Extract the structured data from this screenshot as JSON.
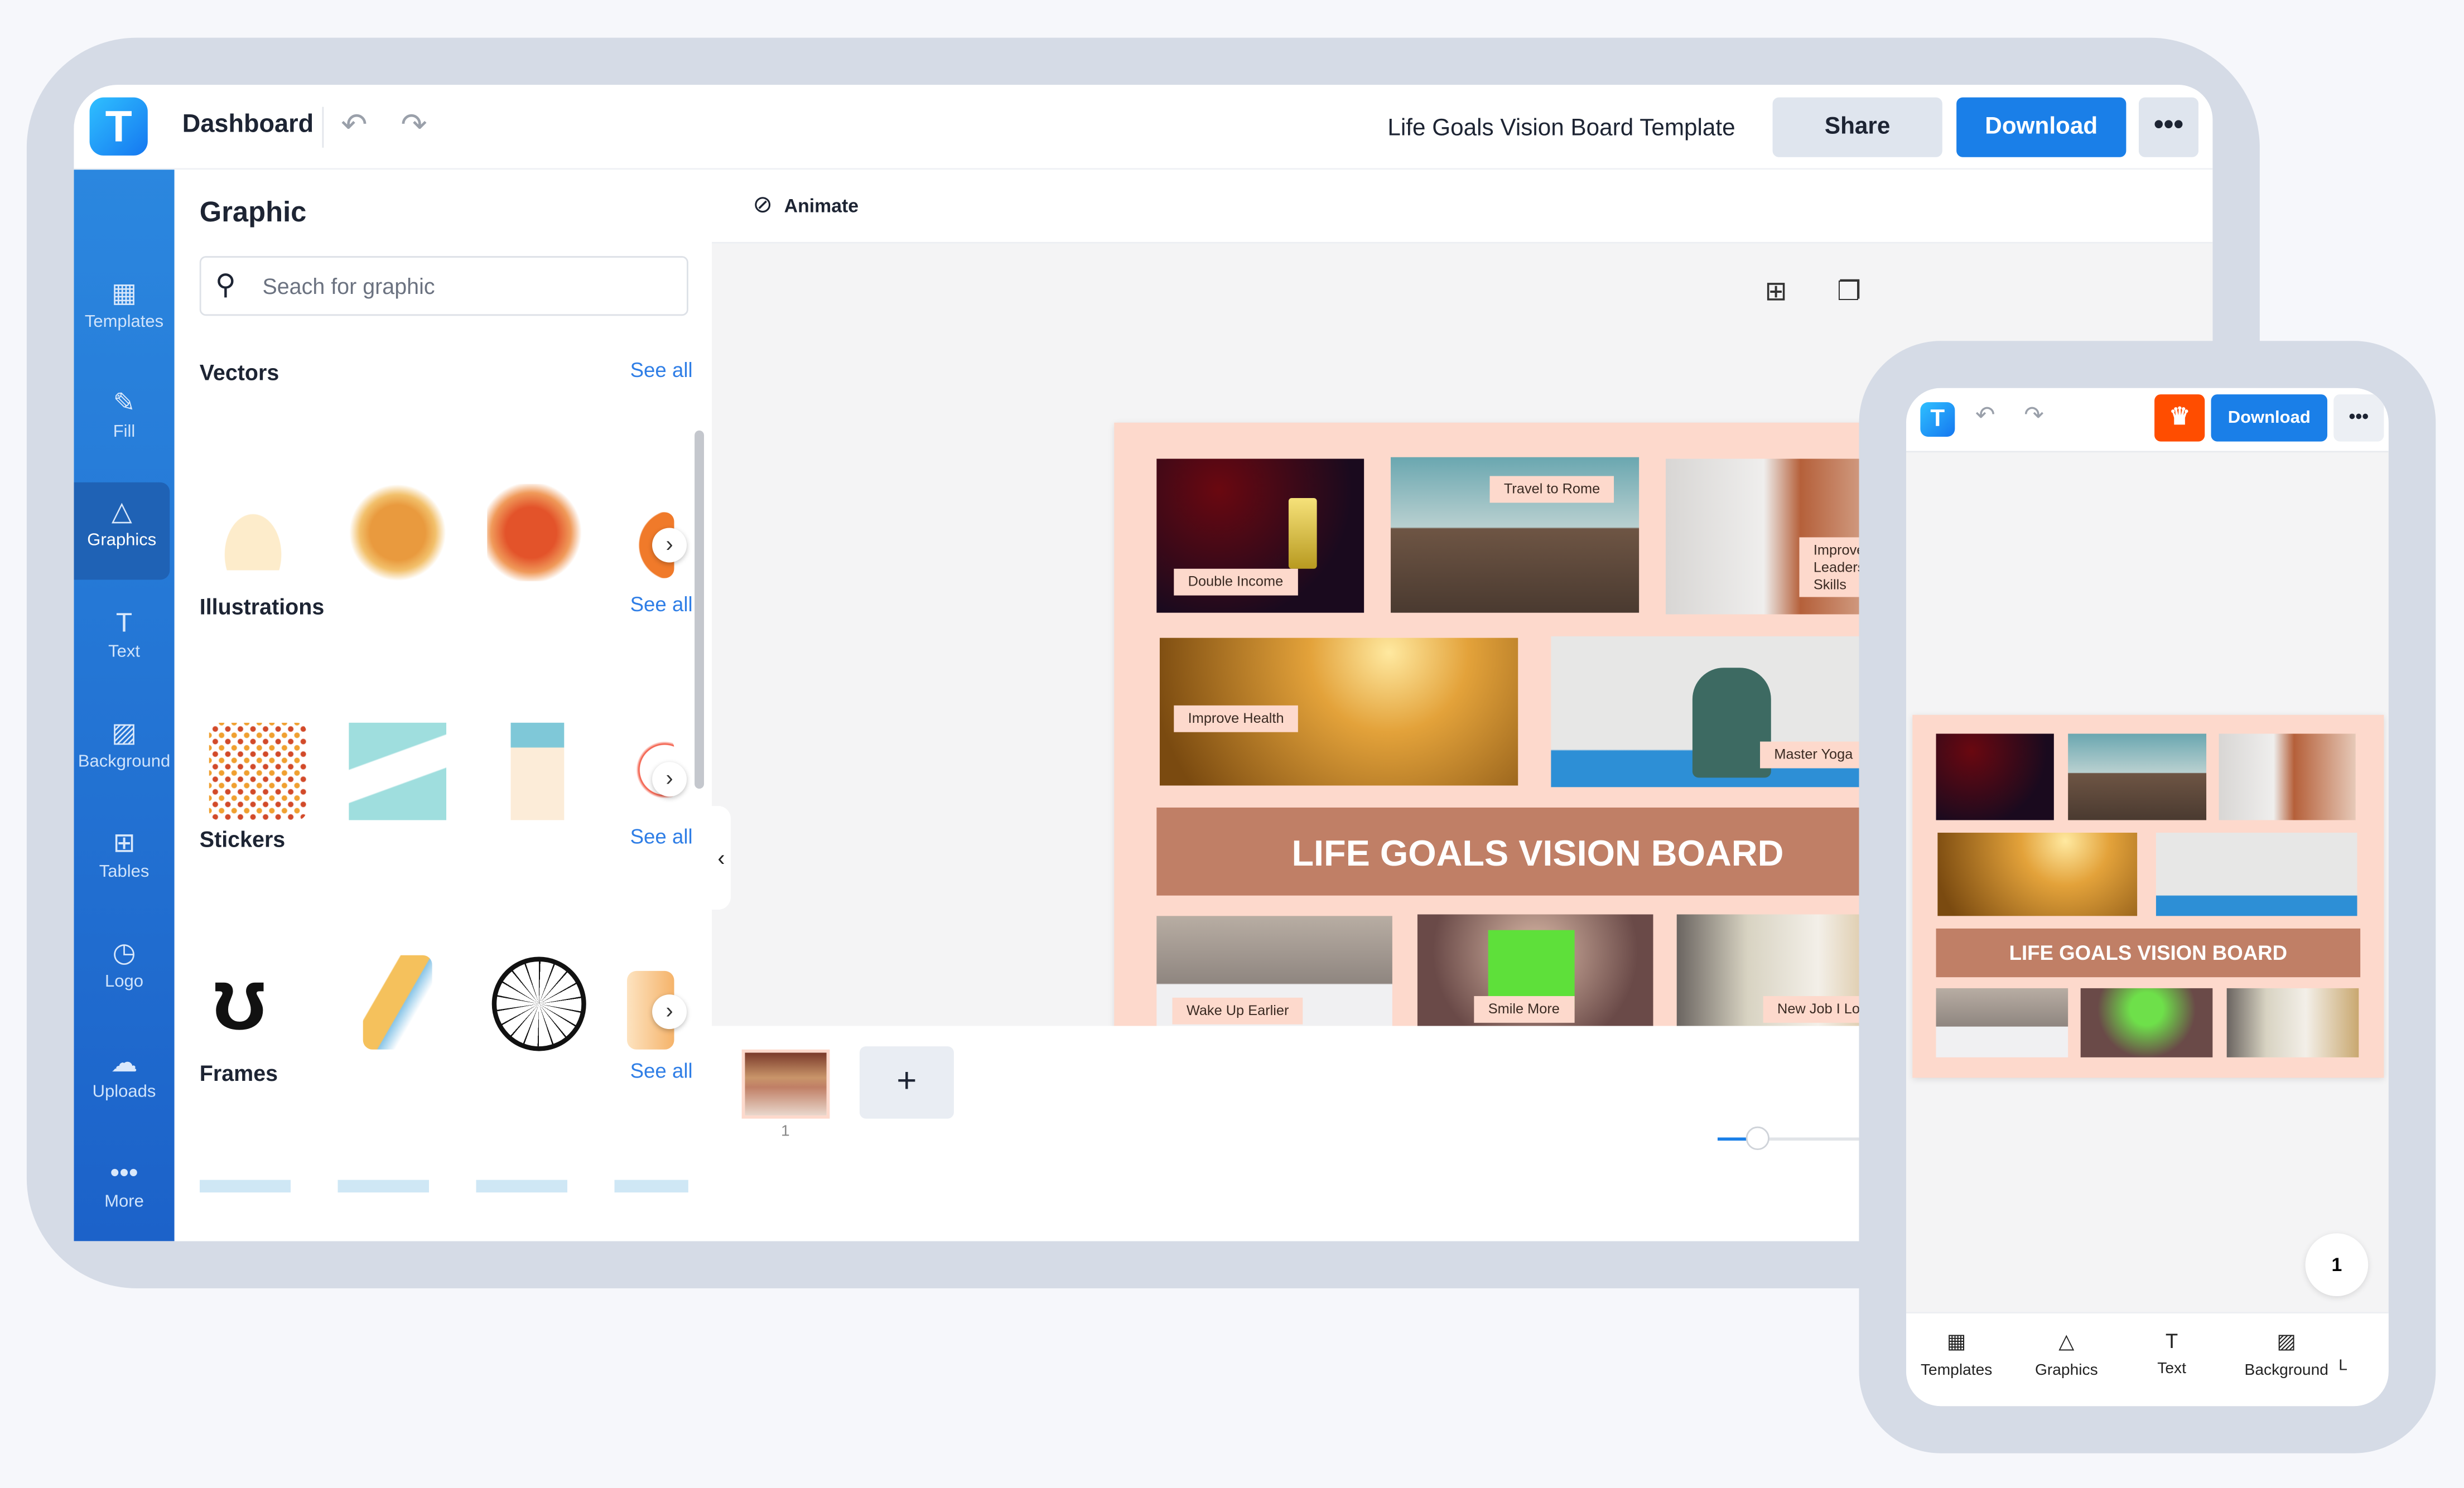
{
  "header": {
    "app_logo": "T",
    "title": "Dashboard",
    "document_title": "Life Goals Vision Board Template",
    "share_label": "Share",
    "download_label": "Download",
    "more_icon": "more-horizontal-icon",
    "undo_icon": "undo-icon",
    "redo_icon": "redo-icon"
  },
  "sidebar": {
    "items": [
      {
        "label": "Templates",
        "icon": "templates-icon",
        "glyph": "▦"
      },
      {
        "label": "Fill",
        "icon": "pencil-icon",
        "glyph": "✎"
      },
      {
        "label": "Graphics",
        "icon": "shapes-icon",
        "glyph": "△"
      },
      {
        "label": "Text",
        "icon": "text-icon",
        "glyph": "T"
      },
      {
        "label": "Background",
        "icon": "background-icon",
        "glyph": "▨"
      },
      {
        "label": "Tables",
        "icon": "table-icon",
        "glyph": "⊞"
      },
      {
        "label": "Logo",
        "icon": "logo-icon",
        "glyph": "◷"
      },
      {
        "label": "Uploads",
        "icon": "upload-cloud-icon",
        "glyph": "☁"
      },
      {
        "label": "More",
        "icon": "more-icon",
        "glyph": "•••"
      }
    ],
    "active": "Graphics"
  },
  "panel": {
    "title": "Graphic",
    "search_placeholder": "Seach for graphic",
    "see_all": "See all",
    "sections": [
      "Vectors",
      "Illustrations",
      "Stickers",
      "Frames"
    ]
  },
  "toolbar": {
    "animate_label": "Animate"
  },
  "board": {
    "title": "LIFE GOALS VISION BOARD",
    "background": "#fdd9cc",
    "banner_color": "#c07f66",
    "goals": [
      "Double Income",
      "Travel to Rome",
      "Improve Leadership Skills",
      "Improve Health",
      "Master Yoga",
      "Wake Up Earlier",
      "Smile More",
      "New Job I Love"
    ]
  },
  "pages": {
    "current": "1",
    "add_label": "+"
  },
  "zoom": {
    "level_percent": 18
  },
  "mobile": {
    "download_label": "Download",
    "premium_icon": "crown-icon",
    "page_count": "1",
    "nav": [
      "Templates",
      "Graphics",
      "Text",
      "Background",
      "L"
    ]
  },
  "colors": {
    "primary": "#1a7fe8",
    "sidebar": "#2a86e0",
    "premium": "#ff4d00"
  }
}
